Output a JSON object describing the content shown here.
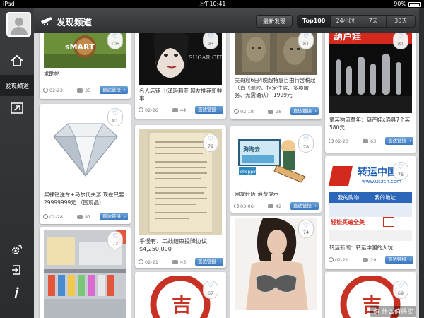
{
  "status_bar": {
    "device": "iPad",
    "time": "上午10:41",
    "battery": "90%"
  },
  "sidebar": {
    "items": [
      {
        "label": "",
        "icon": "home-icon"
      },
      {
        "label": "发现频道",
        "icon": "discover-icon"
      },
      {
        "label": "",
        "icon": "plane-icon"
      },
      {
        "label": "",
        "icon": "settings-icon"
      },
      {
        "label": "",
        "icon": "logout-icon"
      },
      {
        "label": "",
        "icon": "info-icon"
      }
    ]
  },
  "header": {
    "title": "发现频道",
    "latest_label": "最新发现",
    "ranges": [
      "Top100",
      "24小时",
      "7天",
      "30天"
    ],
    "active_range": "Top100"
  },
  "go_label": "直达链接",
  "columns": [
    {
      "cards": [
        {
          "caption": "求助帖",
          "date": "02-23",
          "comments": "35",
          "likes": "105",
          "image": "smart-car-photo"
        },
        {
          "caption": "买裸钻送车+马尔代夫游 现在只要29999999元 （围观品）",
          "date": "02-28",
          "comments": "87",
          "likes": "81",
          "image": "diamond-photo"
        },
        {
          "caption": "",
          "date": "",
          "comments": "",
          "likes": "72",
          "image": "cosmetics-shelf-photo"
        }
      ]
    },
    {
      "cards": [
        {
          "caption": "名人店铺 小泽玛莉亚 网友推荐新鲜事",
          "date": "02-26",
          "comments": "44",
          "likes": "93",
          "image": "sugar-city-photo"
        },
        {
          "caption": "手慢有：二战结束投降协议 $4,250,000",
          "date": "02-21",
          "comments": "43",
          "likes": "79",
          "image": "document-photo"
        },
        {
          "caption": "",
          "date": "",
          "comments": "",
          "likes": "67",
          "image": "seal-stamp-photo"
        }
      ]
    },
    {
      "cards": [
        {
          "caption": "吴哥窟6日4晚超特惠自由行含税起（直飞暹粒、指定住宿、多项服务、无需确认） 1999元",
          "date": "02-18",
          "comments": "28",
          "likes": "81",
          "image": "angkor-photo"
        },
        {
          "caption": "网友经历 消费提示",
          "date": "03-06",
          "comments": "42",
          "likes": "78",
          "image": "taobao-cartoon"
        },
        {
          "caption": "",
          "date": "",
          "comments": "",
          "likes": "74",
          "image": "model-photo"
        }
      ]
    },
    {
      "cards": [
        {
          "caption": "童装物流童年：葫芦娃x通具7个装 580元",
          "date": "02-20",
          "comments": "63",
          "likes": "81",
          "image": "glass-toys-photo",
          "banner": "葫芦娃"
        },
        {
          "caption": "转运新闻：转运中国的大坑",
          "date": "02-21",
          "comments": "29",
          "likes": "76",
          "image": "uszcn-ad",
          "ad_title": "转运中国",
          "ad_url": "www.uszcn.com",
          "ad_nav": [
            "我的购物",
            "我的地址"
          ],
          "ad_promo": "轻松买遍全美"
        },
        {
          "caption": "",
          "date": "",
          "comments": "",
          "likes": "69",
          "image": "seal-stamp-photo"
        }
      ]
    }
  ],
  "watermark": "值 什么值得买"
}
